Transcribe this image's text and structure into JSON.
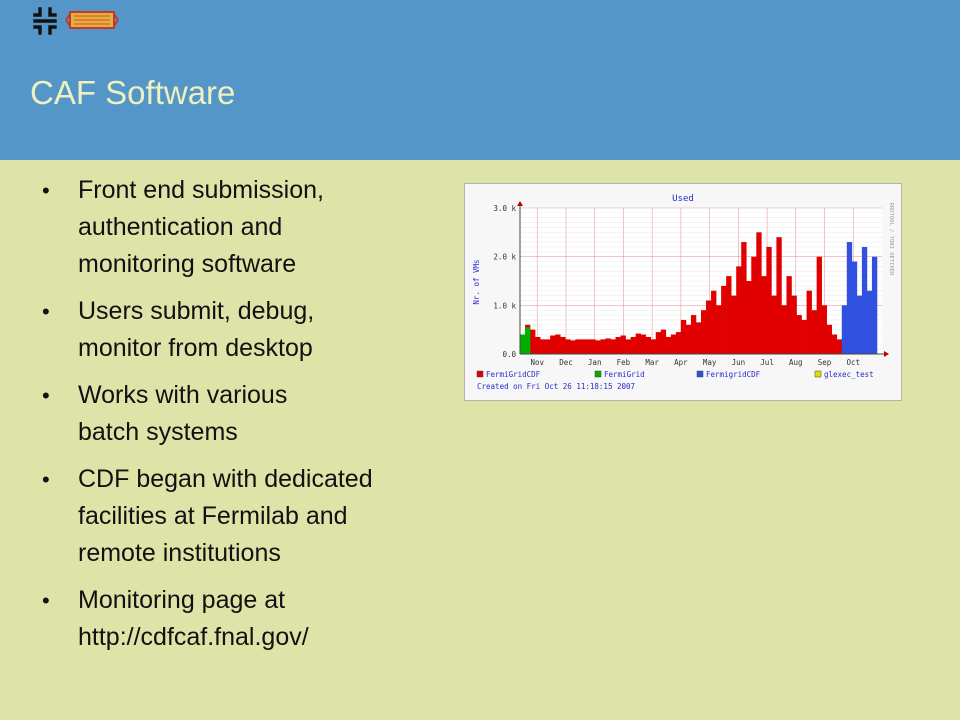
{
  "slide": {
    "title": "CAF Software",
    "bullets": [
      "Front end submission,\nauthentication and\nmonitoring software",
      "Users submit, debug,\nmonitor from desktop",
      "Works with various\nbatch systems",
      "CDF began with dedicated\nfacilities at Fermilab and\nremote institutions",
      "Monitoring page at\nhttp://cdfcaf.fnal.gov/"
    ],
    "colors": {
      "header": "#5496c8",
      "body": "#dee3a8",
      "title_text": "#eef0c0"
    },
    "logos": [
      "fermilab-logo",
      "cdf-logo"
    ]
  },
  "chart_data": {
    "type": "area",
    "title": "Used",
    "ylabel": "Nr. of VMs",
    "ylim": [
      0,
      3000
    ],
    "y_ticks": [
      "0.0",
      "1.0 k",
      "2.0 k",
      "3.0 k"
    ],
    "x_ticks": [
      "Nov",
      "Dec",
      "Jan",
      "Feb",
      "Mar",
      "Apr",
      "May",
      "Jun",
      "Jul",
      "Aug",
      "Sep",
      "Oct"
    ],
    "side_label": "RRDTOOL / TOBI OETIKER",
    "footer": "Created on Fri Oct 26 11:18:15 2007",
    "grid": true,
    "legend_position": "bottom",
    "series": [
      {
        "name": "FermiGridCDF",
        "color": "#e00000",
        "values": [
          250,
          600,
          500,
          350,
          300,
          300,
          380,
          400,
          350,
          300,
          280,
          300,
          300,
          300,
          300,
          280,
          300,
          320,
          300,
          350,
          380,
          300,
          350,
          420,
          400,
          350,
          300,
          450,
          500,
          350,
          400,
          450,
          700,
          600,
          800,
          650,
          900,
          1100,
          1300,
          1000,
          1400,
          1600,
          1200,
          1800,
          2300,
          1500,
          2000,
          2500,
          1600,
          2200,
          1200,
          2400,
          1000,
          1600,
          1200,
          800,
          700,
          1300,
          900,
          2000,
          1000,
          600,
          400,
          300
        ]
      },
      {
        "name": "FermiGrid",
        "color": "#00b000",
        "values": [
          400,
          550
        ]
      },
      {
        "name": "FermigridCDF",
        "color": "#3050e0",
        "values": [
          1000,
          2300,
          1900,
          1200,
          2200,
          1300,
          2000
        ]
      },
      {
        "name": "glexec_test",
        "color": "#e0e000",
        "values": []
      }
    ]
  }
}
